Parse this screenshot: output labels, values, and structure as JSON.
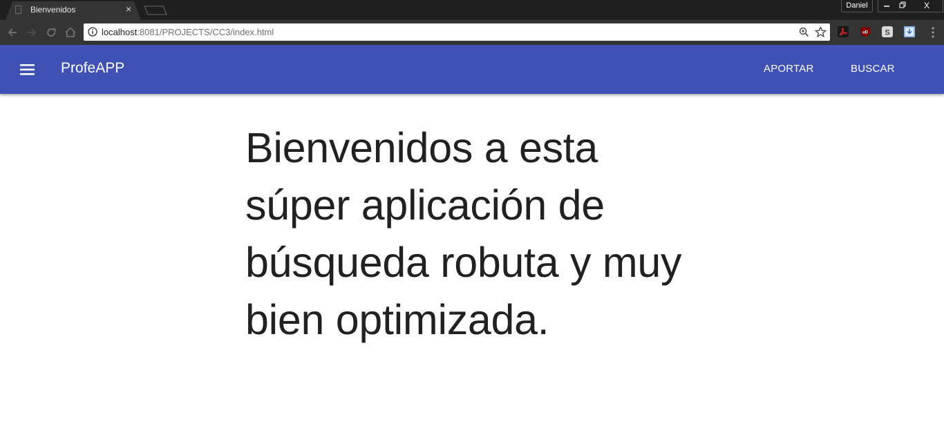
{
  "browser": {
    "tab": {
      "title": "Bienvenidos",
      "close_glyph": "×"
    },
    "profile_name": "Daniel",
    "window_controls": {
      "minimize": "—",
      "restore": "❐",
      "close": "X"
    },
    "address_bar": {
      "url_host": "localhost",
      "url_rest": ":8081/PROJECTS/CC3/index.html"
    },
    "extensions": [
      {
        "icon": "acrobat-extension-icon",
        "color": "#c8102e"
      },
      {
        "icon": "ublock-extension-icon",
        "color": "#800000",
        "label": "uD"
      },
      {
        "icon": "s-extension-icon",
        "color": "#e0e0e0",
        "label": "S"
      },
      {
        "icon": "download-extension-icon",
        "color": "#7aa7e0"
      }
    ]
  },
  "appbar": {
    "title": "ProfeAPP",
    "color": "#3f51b5",
    "nav": [
      {
        "label": "APORTAR"
      },
      {
        "label": "BUSCAR"
      }
    ]
  },
  "main": {
    "heading": "Bienvenidos a esta súper aplicación de búsqueda robuta y muy bien optimizada."
  }
}
